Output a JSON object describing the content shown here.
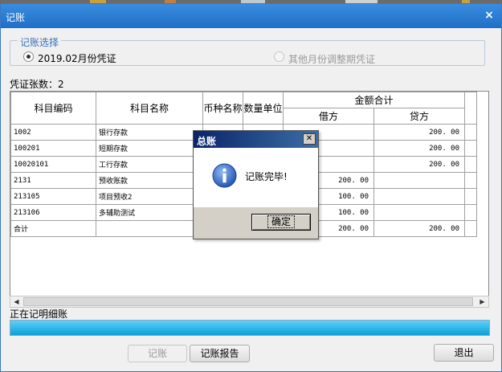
{
  "window": {
    "title": "记账",
    "close_glyph": "×"
  },
  "group": {
    "legend": "记账选择",
    "option1": "2019.02月份凭证",
    "option2": "其他月份调整期凭证"
  },
  "voucher_count_label": "凭证张数：2",
  "table": {
    "headers": {
      "code": "科目编码",
      "name": "科目名称",
      "currency": "币种名称",
      "unit": "数量单位",
      "amount_total": "金额合计",
      "debit": "借方",
      "credit": "贷方"
    },
    "rows": [
      {
        "code": "1002",
        "name": "银行存款",
        "currency": "",
        "unit": "",
        "debit": "",
        "credit": "200. 00"
      },
      {
        "code": "100201",
        "name": "短期存款",
        "currency": "",
        "unit": "",
        "debit": "",
        "credit": "200. 00"
      },
      {
        "code": "10020101",
        "name": "工行存款",
        "currency": "",
        "unit": "",
        "debit": "",
        "credit": "200. 00"
      },
      {
        "code": "2131",
        "name": "预收账款",
        "currency": "",
        "unit": "",
        "debit": "200. 00",
        "credit": ""
      },
      {
        "code": "213105",
        "name": "项目预收2",
        "currency": "",
        "unit": "",
        "debit": "100. 00",
        "credit": ""
      },
      {
        "code": "213106",
        "name": "多辅助测试",
        "currency": "",
        "unit": "",
        "debit": "100. 00",
        "credit": ""
      },
      {
        "code": "合计",
        "name": "",
        "currency": "",
        "unit": "",
        "debit": "200. 00",
        "credit": "200. 00"
      }
    ]
  },
  "scrollbar": {
    "left_arrow": "◀",
    "right_arrow": "▶"
  },
  "status_label": "正在记明细账",
  "progress": {
    "fraction": 1.0
  },
  "buttons": {
    "post": "记账",
    "report": "记账报告",
    "exit": "退出"
  },
  "dialog": {
    "title": "总账",
    "close_glyph": "✕",
    "icon": "info-icon",
    "message": "记账完毕!",
    "ok": "确定"
  },
  "colors": {
    "titlebar": "#2b7fd8",
    "progress": "#0ba1d8",
    "dialog_title": "#0a246a"
  }
}
